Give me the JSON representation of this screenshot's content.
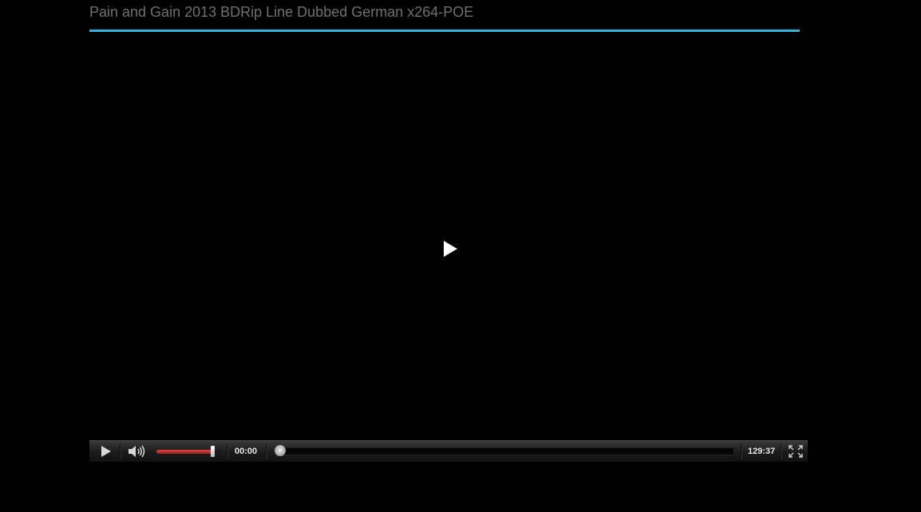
{
  "page": {
    "title": "Pain and Gain 2013 BDRip Line Dubbed German x264-POE",
    "accent_color": "#2fb3d6"
  },
  "player": {
    "big_play_icon": "play-icon",
    "controls": {
      "play_icon": "play-icon",
      "volume_icon": "speaker-icon",
      "volume_level": 0.88,
      "volume_color": "#c03030",
      "current_time": "00:00",
      "progress": 0.0,
      "total_time": "129:37",
      "fullscreen_icon": "fullscreen-icon"
    }
  }
}
